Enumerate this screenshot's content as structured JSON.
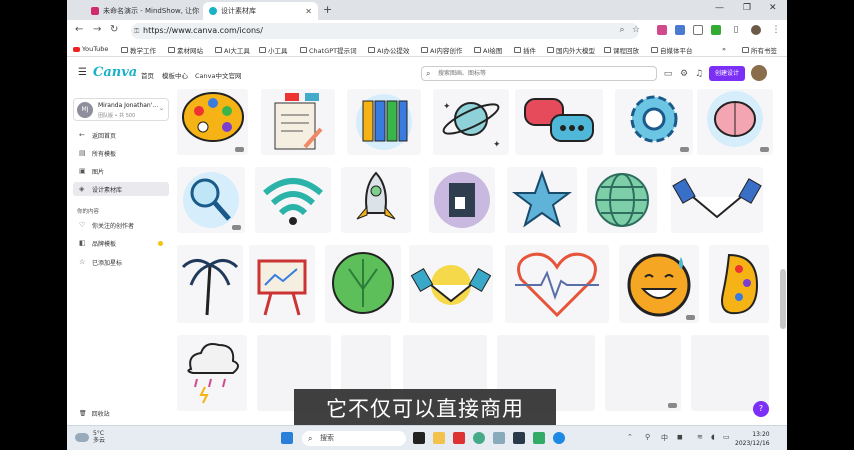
{
  "browser": {
    "tabs": [
      {
        "title": "未命名演示 - MindShow, 让你"
      },
      {
        "title": "设计素材库"
      }
    ],
    "url": "https://www.canva.com/icons/",
    "bookmarks": [
      "YouTube",
      "教学工作",
      "素材网站",
      "AI大工具",
      "小工具",
      "ChatGPT提示词",
      "AI办公提效",
      "AI内容创作",
      "AI绘图",
      "插件",
      "国内外大模型",
      "课程回放",
      "自媒体平台",
      "所有书签"
    ]
  },
  "canva": {
    "logo": "Canva",
    "nav": [
      "首页",
      "模板中心",
      "Canva中文官网"
    ],
    "search_placeholder": "搜索图画、图标等",
    "create_button": "创建设计"
  },
  "sidebar": {
    "account_name": "Miranda Jonathan'...",
    "account_sub": "团队版 • 共 500",
    "avatar_initials": "MJ",
    "items": [
      {
        "label": "返回首页",
        "icon": "arrow-left-icon"
      },
      {
        "label": "所有模板",
        "icon": "template-icon"
      },
      {
        "label": "图片",
        "icon": "image-icon"
      },
      {
        "label": "设计素材库",
        "icon": "elements-icon"
      }
    ],
    "section_label": "你的内容",
    "content_items": [
      {
        "label": "你关注的创作者",
        "icon": "heart-icon"
      },
      {
        "label": "品牌模板",
        "icon": "brand-icon"
      },
      {
        "label": "已添加星标",
        "icon": "star-icon"
      }
    ],
    "trash": "回收站"
  },
  "subtitle": "它不仅可以直接商用",
  "taskbar": {
    "weather_temp": "5°C",
    "weather_desc": "多云",
    "search": "搜索",
    "time": "13:20",
    "date": "2023/12/16"
  },
  "colors": {
    "brand": "#19b2c6",
    "accent": "#7b2ff7"
  }
}
